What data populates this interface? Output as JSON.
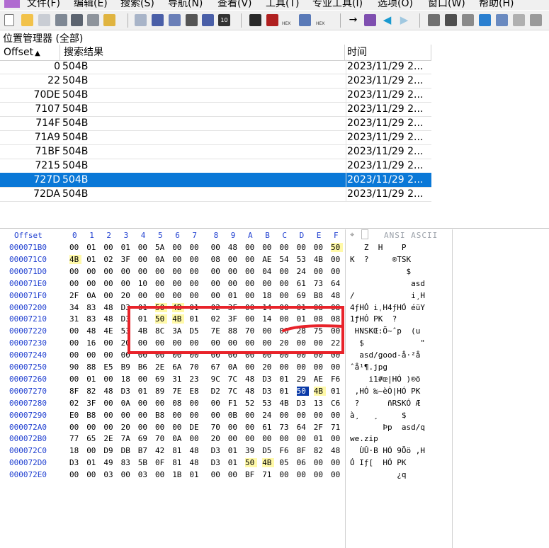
{
  "menubar": {
    "items": [
      "文件(F)",
      "编辑(E)",
      "搜索(S)",
      "导航(N)",
      "查看(V)",
      "工具(T)",
      "专业工具(I)",
      "选项(O)",
      "窗口(W)",
      "帮助(H)"
    ]
  },
  "toolbar": {
    "hex_label": "HEX",
    "icons": [
      "new-file-icon",
      "open-folder-icon",
      "save-icon",
      "print-icon",
      "print-preview-icon",
      "properties-icon",
      "export-icon",
      "undo-icon",
      "copy-icon",
      "paste-icon",
      "clipboard-icon",
      "find-icon",
      "find-next-icon",
      "find-hex-icon",
      "replace-icon",
      "replace-hex-icon",
      "goto-icon",
      "goto-offset-icon",
      "back-icon",
      "forward-icon",
      "disk-icon",
      "ram-icon",
      "calculator-icon",
      "zoom-icon",
      "tools-icon"
    ]
  },
  "position_manager": {
    "title": "位置管理器 (全部)",
    "columns": [
      "Offset",
      "搜索结果",
      "时间"
    ],
    "sort_indicator": "▲",
    "rows": [
      {
        "offset": "0",
        "result": "504B",
        "time": "2023/11/29  2...",
        "selected": false
      },
      {
        "offset": "22",
        "result": "504B",
        "time": "2023/11/29  2...",
        "selected": false
      },
      {
        "offset": "70DE",
        "result": "504B",
        "time": "2023/11/29  2...",
        "selected": false
      },
      {
        "offset": "7107",
        "result": "504B",
        "time": "2023/11/29  2...",
        "selected": false
      },
      {
        "offset": "714F",
        "result": "504B",
        "time": "2023/11/29  2...",
        "selected": false
      },
      {
        "offset": "71A9",
        "result": "504B",
        "time": "2023/11/29  2...",
        "selected": false
      },
      {
        "offset": "71BF",
        "result": "504B",
        "time": "2023/11/29  2...",
        "selected": false
      },
      {
        "offset": "7215",
        "result": "504B",
        "time": "2023/11/29  2...",
        "selected": false
      },
      {
        "offset": "727D",
        "result": "504B",
        "time": "2023/11/29  2...",
        "selected": true
      },
      {
        "offset": "72DA",
        "result": "504B",
        "time": "2023/11/29  2...",
        "selected": false
      }
    ]
  },
  "hex_view": {
    "offset_header": "Offset",
    "column_headers": [
      "0",
      "1",
      "2",
      "3",
      "4",
      "5",
      "6",
      "7",
      "8",
      "9",
      "A",
      "B",
      "C",
      "D",
      "E",
      "F"
    ],
    "ascii_header": "ANSI ASCII",
    "rows": [
      {
        "offset": "000071B0",
        "bytes": [
          "00",
          "01",
          "00",
          "01",
          "00",
          "5A",
          "00",
          "00",
          "00",
          "48",
          "00",
          "00",
          "00",
          "00",
          "00",
          "50"
        ],
        "hl": [
          15
        ],
        "cur": [],
        "ascii": "   Z  H    P",
        "ascii_hl": "P"
      },
      {
        "offset": "000071C0",
        "bytes": [
          "4B",
          "01",
          "02",
          "3F",
          "00",
          "0A",
          "00",
          "00",
          "08",
          "00",
          "00",
          "AE",
          "54",
          "53",
          "4B",
          "00"
        ],
        "hl": [
          0
        ],
        "cur": [],
        "ascii": "K  ?     ®TSK",
        "ascii_hl": "K"
      },
      {
        "offset": "000071D0",
        "bytes": [
          "00",
          "00",
          "00",
          "00",
          "00",
          "00",
          "00",
          "00",
          "00",
          "00",
          "00",
          "04",
          "00",
          "24",
          "00",
          "00"
        ],
        "hl": [],
        "cur": [],
        "ascii": "            $",
        "ascii_hl": ""
      },
      {
        "offset": "000071E0",
        "bytes": [
          "00",
          "00",
          "00",
          "00",
          "10",
          "00",
          "00",
          "00",
          "00",
          "00",
          "00",
          "00",
          "00",
          "61",
          "73",
          "64"
        ],
        "hl": [],
        "cur": [],
        "ascii": "             asd",
        "ascii_hl": ""
      },
      {
        "offset": "000071F0",
        "bytes": [
          "2F",
          "0A",
          "00",
          "20",
          "00",
          "00",
          "00",
          "00",
          "00",
          "01",
          "00",
          "18",
          "00",
          "69",
          "B8",
          "48"
        ],
        "hl": [],
        "cur": [],
        "ascii": "/            i¸H",
        "ascii_hl": ""
      },
      {
        "offset": "00007200",
        "bytes": [
          "34",
          "83",
          "48",
          "D3",
          "01",
          "50",
          "4B",
          "01",
          "02",
          "3F",
          "00",
          "14",
          "00",
          "01",
          "08",
          "08"
        ],
        "hl": [
          5,
          6
        ],
        "cur": [],
        "ascii": "4ƒHÓ iˌH4ƒHÓ éüY",
        "ascii_hl": ""
      },
      {
        "offset": "00007210",
        "bytes": [
          "31",
          "83",
          "48",
          "D3",
          "01",
          "50",
          "4B",
          "01",
          "02",
          "3F",
          "00",
          "14",
          "00",
          "01",
          "08",
          "08"
        ],
        "hl": [
          5,
          6
        ],
        "cur": [],
        "ascii": "1ƒHÓ PK  ?",
        "ascii_hl": "PK"
      },
      {
        "offset": "00007220",
        "bytes": [
          "00",
          "48",
          "4E",
          "53",
          "4B",
          "8C",
          "3A",
          "D5",
          "7E",
          "88",
          "70",
          "00",
          "00",
          "28",
          "75",
          "00"
        ],
        "hl": [],
        "cur": [],
        "ascii": " HNSKŒ:Õ~ˆp  (u",
        "ascii_hl": ""
      },
      {
        "offset": "00007230",
        "bytes": [
          "00",
          "16",
          "00",
          "20",
          "00",
          "00",
          "00",
          "00",
          "00",
          "00",
          "00",
          "00",
          "20",
          "00",
          "00",
          "22"
        ],
        "hl": [],
        "cur": [],
        "ascii": "  $            \"",
        "ascii_hl": ""
      },
      {
        "offset": "00007240",
        "bytes": [
          "00",
          "00",
          "00",
          "00",
          "00",
          "00",
          "00",
          "00",
          "00",
          "00",
          "00",
          "00",
          "00",
          "00",
          "00",
          "00"
        ],
        "hl": [],
        "cur": [],
        "ascii": "  asd/good-å·²å",
        "ascii_hl": ""
      },
      {
        "offset": "00007250",
        "bytes": [
          "90",
          "88",
          "E5",
          "B9",
          "B6",
          "2E",
          "6A",
          "70",
          "67",
          "0A",
          "00",
          "20",
          "00",
          "00",
          "00",
          "00"
        ],
        "hl": [],
        "cur": [],
        "ascii": "ˆå¹¶.jpg",
        "ascii_hl": ""
      },
      {
        "offset": "00007260",
        "bytes": [
          "00",
          "01",
          "00",
          "18",
          "00",
          "69",
          "31",
          "23",
          "9C",
          "7C",
          "48",
          "D3",
          "01",
          "29",
          "AE",
          "F6"
        ],
        "hl": [],
        "cur": [],
        "ascii": "    i1#œ|HÓ )®ö",
        "ascii_hl": ""
      },
      {
        "offset": "00007270",
        "bytes": [
          "8F",
          "82",
          "48",
          "D3",
          "01",
          "89",
          "7E",
          "E8",
          "D2",
          "7C",
          "48",
          "D3",
          "01",
          "50",
          "4B",
          "01"
        ],
        "hl": [
          14
        ],
        "cur": [
          13
        ],
        "ascii": " ‚HÓ ‰~èÒ|HÓ PK",
        "ascii_hl": "PK"
      },
      {
        "offset": "00007280",
        "bytes": [
          "02",
          "3F",
          "00",
          "0A",
          "00",
          "00",
          "08",
          "00",
          "00",
          "F1",
          "52",
          "53",
          "4B",
          "D3",
          "13",
          "C6"
        ],
        "hl": [],
        "cur": [],
        "ascii": " ?      ñRSKÓ Æ",
        "ascii_hl": ""
      },
      {
        "offset": "00007290",
        "bytes": [
          "E0",
          "B8",
          "00",
          "00",
          "00",
          "B8",
          "00",
          "00",
          "00",
          "0B",
          "00",
          "24",
          "00",
          "00",
          "00",
          "00"
        ],
        "hl": [],
        "cur": [],
        "ascii": "à¸   ¸     $",
        "ascii_hl": ""
      },
      {
        "offset": "000072A0",
        "bytes": [
          "00",
          "00",
          "00",
          "20",
          "00",
          "00",
          "00",
          "DE",
          "70",
          "00",
          "00",
          "61",
          "73",
          "64",
          "2F",
          "71"
        ],
        "hl": [],
        "cur": [],
        "ascii": "       Þp  asd/q",
        "ascii_hl": ""
      },
      {
        "offset": "000072B0",
        "bytes": [
          "77",
          "65",
          "2E",
          "7A",
          "69",
          "70",
          "0A",
          "00",
          "20",
          "00",
          "00",
          "00",
          "00",
          "00",
          "01",
          "00"
        ],
        "hl": [],
        "cur": [],
        "ascii": "we.zip",
        "ascii_hl": ""
      },
      {
        "offset": "000072C0",
        "bytes": [
          "18",
          "00",
          "D9",
          "DB",
          "B7",
          "42",
          "81",
          "48",
          "D3",
          "01",
          "39",
          "D5",
          "F6",
          "8F",
          "82",
          "48"
        ],
        "hl": [],
        "cur": [],
        "ascii": "  ÙÛ·B HÓ 9Õö ‚H",
        "ascii_hl": ""
      },
      {
        "offset": "000072D0",
        "bytes": [
          "D3",
          "01",
          "49",
          "83",
          "5B",
          "0F",
          "81",
          "48",
          "D3",
          "01",
          "50",
          "4B",
          "05",
          "06",
          "00",
          "00"
        ],
        "hl": [
          10,
          11
        ],
        "cur": [],
        "ascii": "Ó Iƒ[  HÓ PK",
        "ascii_hl": "PK"
      },
      {
        "offset": "000072E0",
        "bytes": [
          "00",
          "00",
          "03",
          "00",
          "03",
          "00",
          "1B",
          "01",
          "00",
          "00",
          "BF",
          "71",
          "00",
          "00",
          "00",
          "00"
        ],
        "hl": [],
        "cur": [],
        "ascii": "          ¿q",
        "ascii_hl": ""
      }
    ]
  },
  "colors": {
    "selection": "#0a78d7",
    "highlight": "#fff9a8",
    "offset_blue": "#1f3fd0",
    "annotation_red": "#e8232a"
  }
}
